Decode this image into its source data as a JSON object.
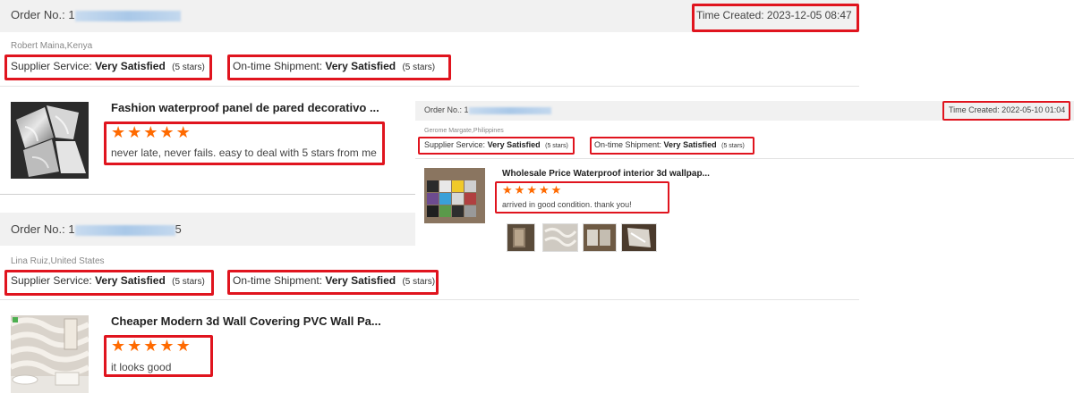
{
  "colors": {
    "highlight": "#e0141e",
    "star": "#ff6a00",
    "header_bg": "#f1f1f1"
  },
  "review1": {
    "order_label": "Order No.:",
    "order_prefix": "1",
    "order_suffix": "",
    "time_created": "Time Created: 2023-12-05 08:47",
    "reviewer": "Robert Maina,Kenya",
    "supplier_label": "Supplier Service:",
    "supplier_value": "Very Satisfied",
    "supplier_stars": "(5 stars)",
    "shipment_label": "On-time Shipment:",
    "shipment_value": "Very Satisfied",
    "shipment_stars": "(5 stars)",
    "product_title": "Fashion waterproof panel de pared decorativo ...",
    "rating": 5,
    "comment": "never late, never fails. easy to deal with 5 stars from me"
  },
  "review2": {
    "order_label": "Order No.:",
    "order_prefix": "1",
    "order_suffix": "5",
    "reviewer": "Lina Ruiz,United States",
    "supplier_label": "Supplier Service:",
    "supplier_value": "Very Satisfied",
    "supplier_stars": "(5 stars)",
    "shipment_label": "On-time Shipment:",
    "shipment_value": "Very Satisfied",
    "shipment_stars": "(5 stars)",
    "product_title": "Cheaper Modern 3d Wall Covering PVC Wall Pa...",
    "rating": 5,
    "comment": "it looks good"
  },
  "review3": {
    "order_label": "Order No.:",
    "order_prefix": "1",
    "time_created": "Time Created: 2022-05-10 01:04",
    "reviewer": "Gerome Margate,Philippines",
    "supplier_label": "Supplier Service:",
    "supplier_value": "Very Satisfied",
    "supplier_stars": "(5 stars)",
    "shipment_label": "On-time Shipment:",
    "shipment_value": "Very Satisfied",
    "shipment_stars": "(5 stars)",
    "product_title": "Wholesale Price Waterproof interior 3d wallpap...",
    "rating": 5,
    "comment": "arrived in good condition. thank you!",
    "photo_count": 4
  }
}
